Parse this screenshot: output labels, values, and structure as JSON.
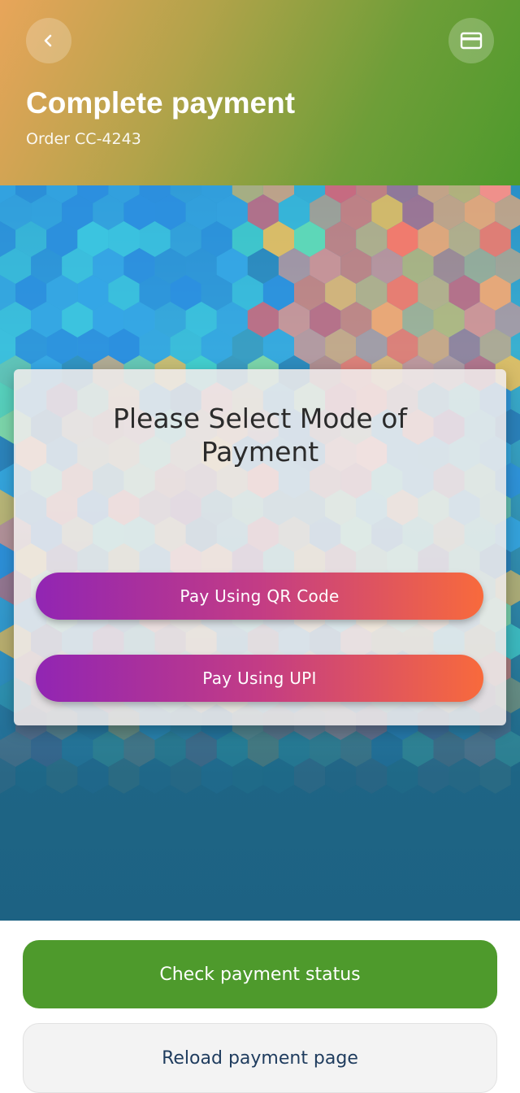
{
  "header": {
    "title": "Complete payment",
    "order": "Order CC-4243",
    "back_icon": "chevron-left-icon",
    "card_icon": "credit-card-icon"
  },
  "payment_card": {
    "title": "Please Select Mode of Payment",
    "options": [
      {
        "label": "Pay Using QR Code"
      },
      {
        "label": "Pay Using UPI"
      }
    ]
  },
  "actions": {
    "check_status": "Check payment status",
    "reload": "Reload payment page"
  },
  "colors": {
    "primary_green": "#4e9a2c",
    "pill_start": "#9125b3",
    "pill_end": "#f86a3c",
    "secondary_text": "#1f3c5e"
  }
}
